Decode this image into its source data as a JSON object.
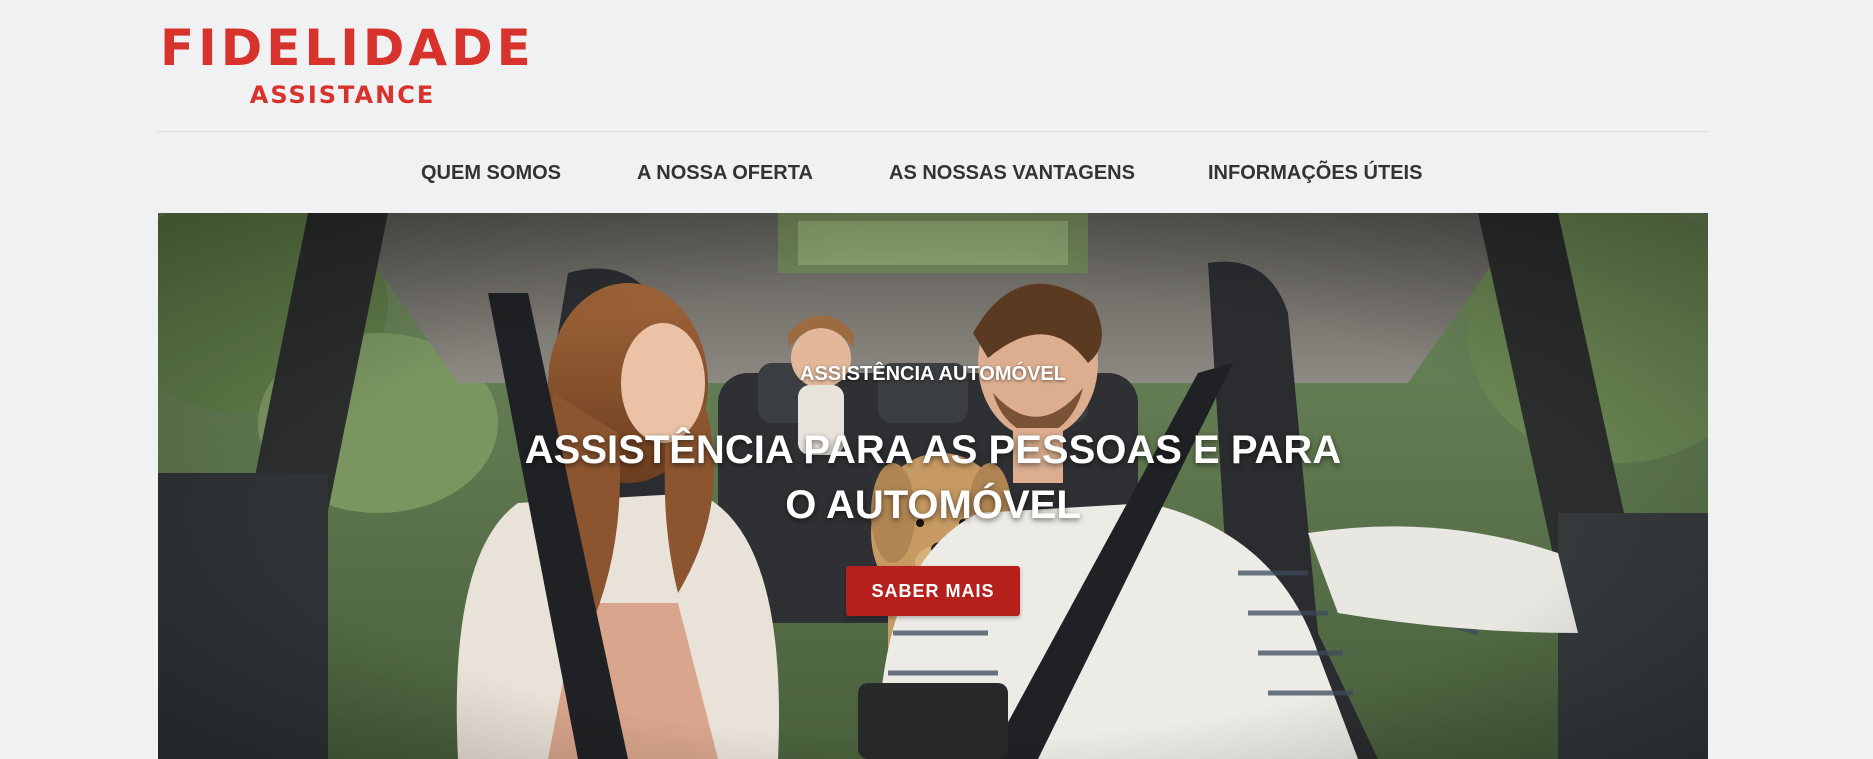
{
  "brand": {
    "name": "FIDELIDADE",
    "sub": "ASSISTANCE",
    "color": "#d8322c"
  },
  "nav": {
    "items": [
      {
        "label": "QUEM SOMOS"
      },
      {
        "label": "A NOSSA OFERTA"
      },
      {
        "label": "AS NOSSAS VANTAGENS"
      },
      {
        "label": "INFORMAÇÕES ÚTEIS"
      }
    ]
  },
  "hero": {
    "eyebrow": "ASSISTÊNCIA AUTOMÓVEL",
    "headline": "ASSISTÊNCIA PARA AS PESSOAS E PARA O AUTOMÓVEL",
    "cta_label": "SABER MAIS",
    "cta_color": "#b5201c",
    "image": "family-in-car-with-dog-photo"
  }
}
